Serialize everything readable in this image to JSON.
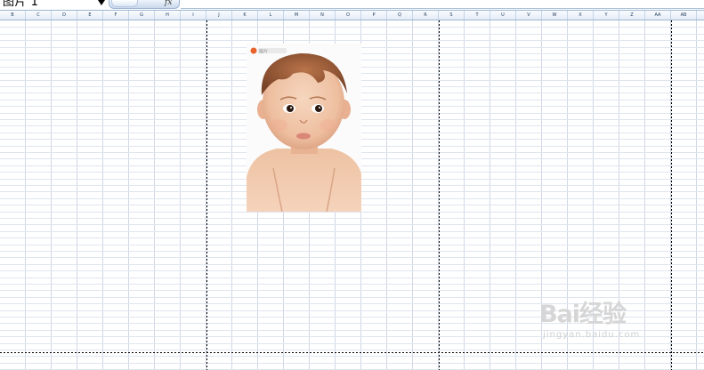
{
  "name_box": {
    "value": "图片 1"
  },
  "formula_bar": {
    "fx_label": "fx",
    "value": ""
  },
  "columns": [
    "B",
    "C",
    "D",
    "E",
    "F",
    "G",
    "H",
    "I",
    "J",
    "K",
    "L",
    "M",
    "N",
    "O",
    "P",
    "Q",
    "R",
    "S",
    "T",
    "U",
    "V",
    "W",
    "X",
    "Y",
    "Z",
    "AA",
    "AB"
  ],
  "picture": {
    "name": "图片 1",
    "logo_text": "图片"
  },
  "watermark": {
    "main": "Bai经验",
    "url": "jingyan.baidu.com"
  }
}
